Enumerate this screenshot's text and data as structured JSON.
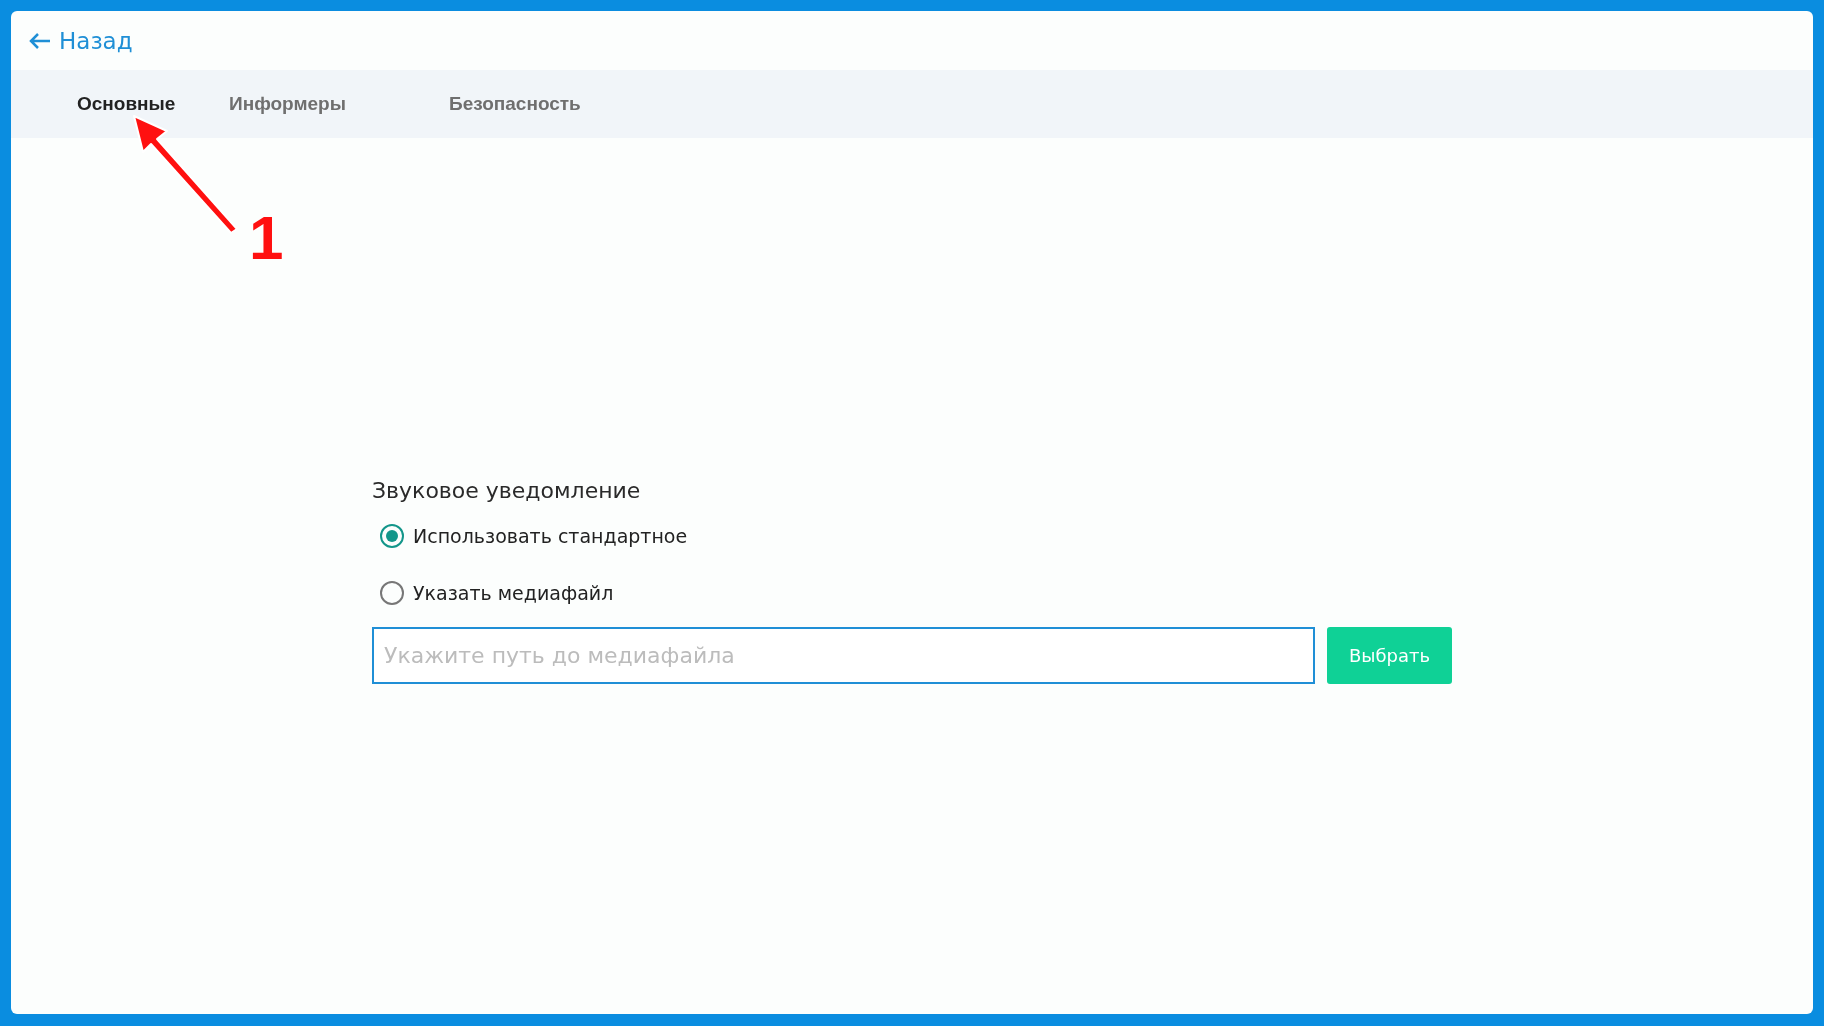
{
  "back_link": {
    "label": "Назад"
  },
  "tabs": [
    {
      "label": "Основные",
      "selected": true
    },
    {
      "label": "Информеры",
      "selected": false
    },
    {
      "label": "Безопасность",
      "selected": false
    }
  ],
  "sound_notification": {
    "title": "Звуковое уведомление",
    "options": [
      {
        "label": "Использовать стандартное",
        "selected": true
      },
      {
        "label": "Указать медиафайл",
        "selected": false
      }
    ],
    "path_field": {
      "placeholder": "Укажите путь до медиафайла"
    },
    "choose_button": "Выбрать"
  },
  "annotation": {
    "label": "1"
  }
}
